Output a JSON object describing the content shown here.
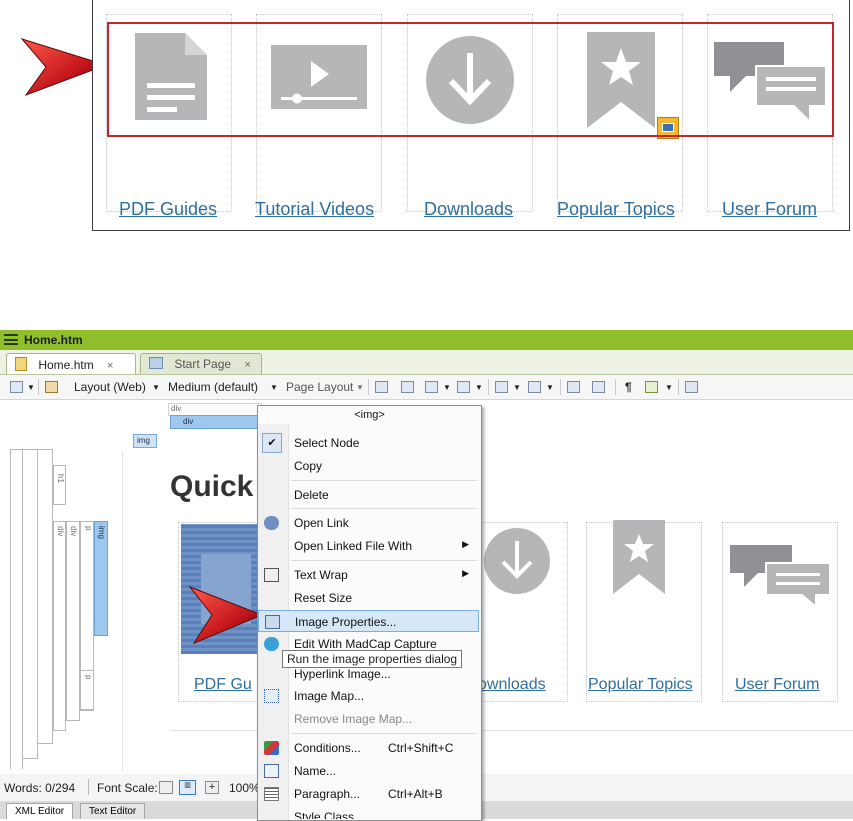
{
  "top_illustration": {
    "links": [
      "PDF Guides",
      "Tutorial Videos",
      "Downloads",
      "Popular Topics",
      "User Forum"
    ]
  },
  "window": {
    "title": "Home.htm",
    "tabs": [
      {
        "label": "Home.htm",
        "close": "×"
      },
      {
        "label": "Start Page",
        "close": "×"
      }
    ],
    "toolbar": {
      "layout": "Layout (Web)",
      "medium": "Medium (default)",
      "page_layout": "Page Layout"
    }
  },
  "editor": {
    "structure_tags": {
      "div_outer": "div",
      "div_inner": "div",
      "img": "img",
      "h1": "h1",
      "div_a": "div",
      "div_b": "div",
      "p_a": "p",
      "img_v": "img",
      "p_b": "p"
    },
    "heading": "Quick",
    "links": [
      "PDF Gu",
      "ownloads",
      "Popular Topics",
      "User Forum"
    ]
  },
  "status": {
    "words": "Words: 0/294",
    "font_scale": "Font Scale:",
    "zoom": "100%"
  },
  "bottom_tabs": [
    "XML Editor",
    "Text Editor"
  ],
  "context_menu": {
    "header": "<img>",
    "items": [
      {
        "label": "Select Node",
        "shortcut": ""
      },
      {
        "label": "Copy",
        "shortcut": ""
      },
      {
        "label": "Delete",
        "shortcut": ""
      },
      {
        "label": "Open Link",
        "shortcut": ""
      },
      {
        "label": "Open Linked File With",
        "shortcut": ""
      },
      {
        "label": "Text Wrap",
        "shortcut": ""
      },
      {
        "label": "Reset Size",
        "shortcut": ""
      },
      {
        "label": "Image Properties...",
        "shortcut": ""
      },
      {
        "label": "Edit With MadCap Capture",
        "shortcut": ""
      },
      {
        "label": "Hyperlink Image...",
        "shortcut": ""
      },
      {
        "label": "Image Map...",
        "shortcut": ""
      },
      {
        "label": "Remove Image Map...",
        "shortcut": ""
      },
      {
        "label": "Conditions...",
        "shortcut": "Ctrl+Shift+C"
      },
      {
        "label": "Name...",
        "shortcut": ""
      },
      {
        "label": "Paragraph...",
        "shortcut": "Ctrl+Alt+B"
      },
      {
        "label": "Style Class",
        "shortcut": ""
      }
    ],
    "tooltip": "Run the image properties dialog"
  },
  "colors": {
    "titlebar": "#8fbf2a",
    "highlight_rect": "#c4252c",
    "link": "#2f6f9f",
    "icon_grey": "#b4b6b8",
    "menu_highlight": "#d6e8f8"
  }
}
